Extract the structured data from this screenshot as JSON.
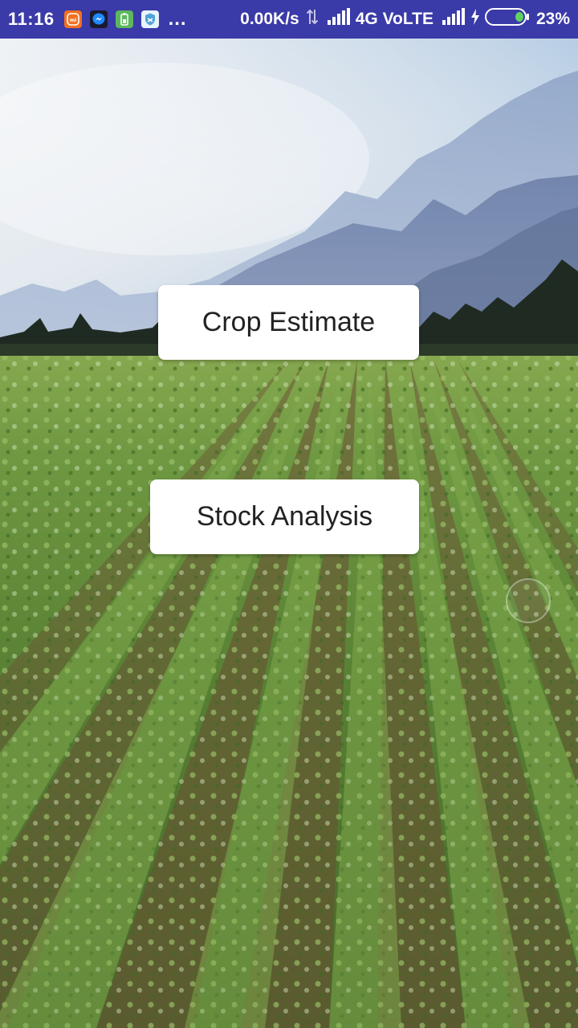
{
  "status_bar": {
    "time": "11:16",
    "notification_icons": [
      "mi-icon",
      "messenger-icon",
      "battery-saver-icon",
      "shield-app-icon"
    ],
    "more": "...",
    "net_speed": "0.00K/s",
    "network": "4G VoLTE",
    "battery_percent": "23%"
  },
  "main": {
    "buttons": [
      {
        "label": "Crop Estimate"
      },
      {
        "label": "Stock Analysis"
      }
    ]
  },
  "colors": {
    "status_bar": "#3a3aa8",
    "button_bg": "#ffffff",
    "button_text": "#222222"
  }
}
